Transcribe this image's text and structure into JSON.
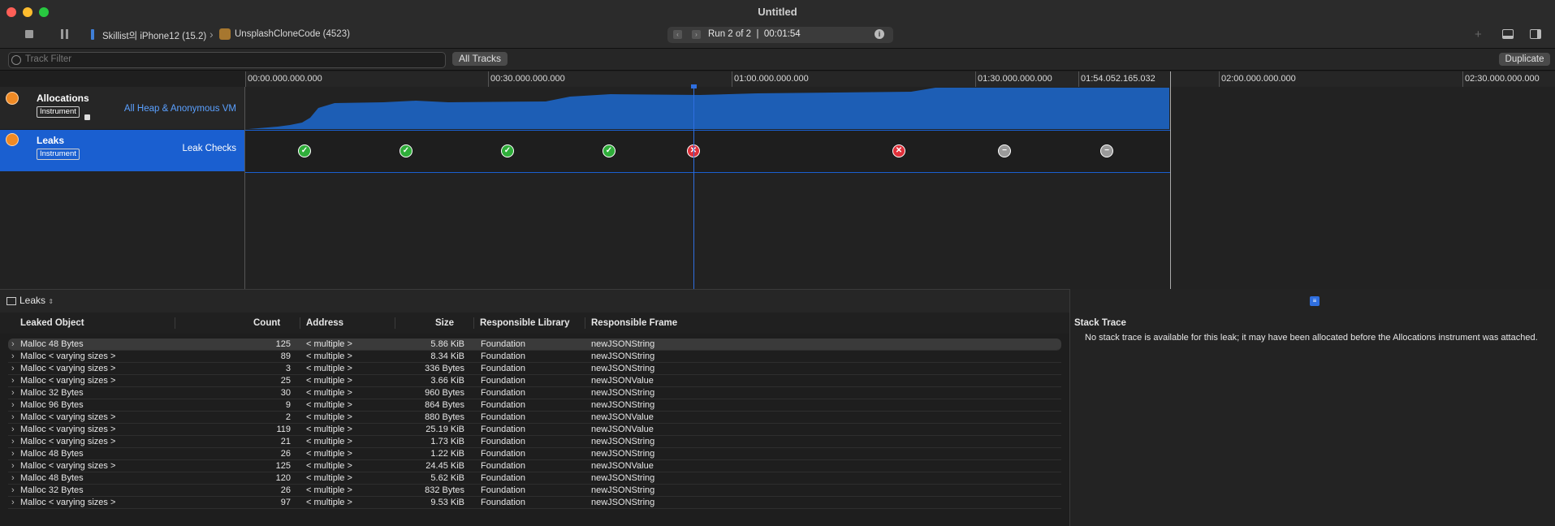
{
  "window": {
    "title": "Untitled"
  },
  "toolbar": {
    "device": "Skillist의 iPhone12 (15.2)",
    "app": "UnsplashCloneCode (4523)",
    "run_label": "Run 2 of 2",
    "run_time": "00:01:54"
  },
  "filter": {
    "placeholder": "Track Filter",
    "all_tracks": "All Tracks",
    "duplicate": "Duplicate"
  },
  "ruler": {
    "ticks": [
      "00:00.000.000.000",
      "00:30.000.000.000",
      "01:00.000.000.000",
      "01:30.000.000.000",
      "01:54.052.165.032",
      "02:00.000.000.000",
      "02:30.000.000.000"
    ]
  },
  "tracks": [
    {
      "name": "Allocations",
      "badge": "Instrument",
      "detail": "All Heap & Anonymous VM"
    },
    {
      "name": "Leaks",
      "badge": "Instrument",
      "detail": "Leak Checks"
    }
  ],
  "leak_checks": [
    {
      "status": "ok"
    },
    {
      "status": "ok"
    },
    {
      "status": "ok"
    },
    {
      "status": "ok"
    },
    {
      "status": "leak"
    },
    {
      "status": "leak"
    },
    {
      "status": "none"
    },
    {
      "status": "none"
    }
  ],
  "bottom": {
    "view_selector": "Leaks",
    "columns": [
      "Leaked Object",
      "Count",
      "Address",
      "Size",
      "Responsible Library",
      "Responsible Frame"
    ],
    "rows": [
      [
        "Malloc 48 Bytes",
        "125",
        "< multiple >",
        "5.86 KiB",
        "Foundation",
        "newJSONString"
      ],
      [
        "Malloc < varying sizes >",
        "89",
        "< multiple >",
        "8.34 KiB",
        "Foundation",
        "newJSONString"
      ],
      [
        "Malloc < varying sizes >",
        "3",
        "< multiple >",
        "336 Bytes",
        "Foundation",
        "newJSONString"
      ],
      [
        "Malloc < varying sizes >",
        "25",
        "< multiple >",
        "3.66 KiB",
        "Foundation",
        "newJSONValue"
      ],
      [
        "Malloc 32 Bytes",
        "30",
        "< multiple >",
        "960 Bytes",
        "Foundation",
        "newJSONString"
      ],
      [
        "Malloc 96 Bytes",
        "9",
        "< multiple >",
        "864 Bytes",
        "Foundation",
        "newJSONString"
      ],
      [
        "Malloc < varying sizes >",
        "2",
        "< multiple >",
        "880 Bytes",
        "Foundation",
        "newJSONValue"
      ],
      [
        "Malloc < varying sizes >",
        "119",
        "< multiple >",
        "25.19 KiB",
        "Foundation",
        "newJSONValue"
      ],
      [
        "Malloc < varying sizes >",
        "21",
        "< multiple >",
        "1.73 KiB",
        "Foundation",
        "newJSONString"
      ],
      [
        "Malloc 48 Bytes",
        "26",
        "< multiple >",
        "1.22 KiB",
        "Foundation",
        "newJSONString"
      ],
      [
        "Malloc < varying sizes >",
        "125",
        "< multiple >",
        "24.45 KiB",
        "Foundation",
        "newJSONValue"
      ],
      [
        "Malloc 48 Bytes",
        "120",
        "< multiple >",
        "5.62 KiB",
        "Foundation",
        "newJSONString"
      ],
      [
        "Malloc 32 Bytes",
        "26",
        "< multiple >",
        "832 Bytes",
        "Foundation",
        "newJSONString"
      ],
      [
        "Malloc < varying sizes >",
        "97",
        "< multiple >",
        "9.53 KiB",
        "Foundation",
        "newJSONString"
      ]
    ]
  },
  "stack_trace": {
    "title": "Stack Trace",
    "message": "No stack trace is available for this leak; it may have been allocated before the Allocations instrument was attached."
  },
  "colors": {
    "accent": "#1a5fd0",
    "graph_fill": "#1d5eb5",
    "ok": "#2fae3a",
    "leak": "#e0303a",
    "none": "#9a9a9a"
  }
}
